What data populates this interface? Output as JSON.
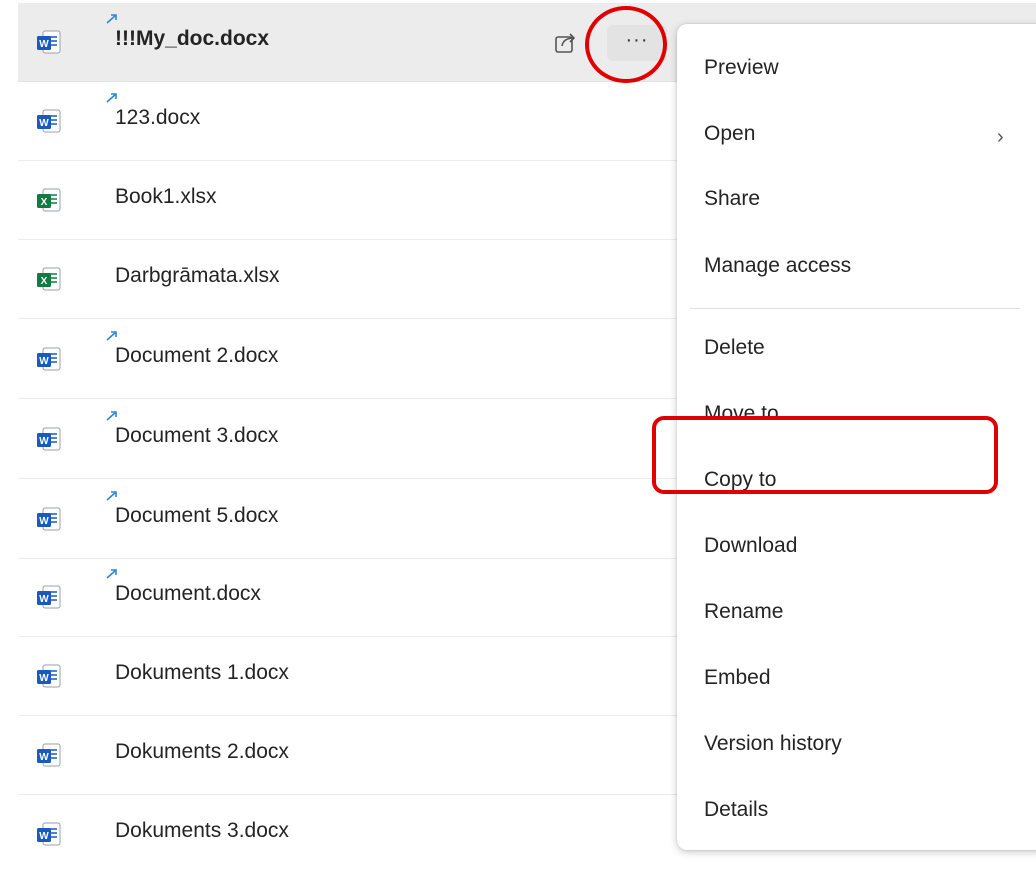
{
  "files": [
    {
      "name": "!!!My_doc.docx",
      "type": "word",
      "synced": true,
      "selected": true
    },
    {
      "name": "123.docx",
      "type": "word",
      "synced": true
    },
    {
      "name": "Book1.xlsx",
      "type": "excel",
      "synced": false
    },
    {
      "name": "Darbgrāmata.xlsx",
      "type": "excel",
      "synced": false
    },
    {
      "name": "Document 2.docx",
      "type": "word",
      "synced": true
    },
    {
      "name": "Document 3.docx",
      "type": "word",
      "synced": true
    },
    {
      "name": "Document 5.docx",
      "type": "word",
      "synced": true
    },
    {
      "name": "Document.docx",
      "type": "word",
      "synced": true
    },
    {
      "name": "Dokuments 1.docx",
      "type": "word",
      "synced": false
    },
    {
      "name": "Dokuments 2.docx",
      "type": "word",
      "synced": false
    },
    {
      "name": "Dokuments 3.docx",
      "type": "word",
      "synced": false
    }
  ],
  "row_actions": {
    "more_label": "···",
    "share_icon": "share-icon"
  },
  "menu": {
    "items": [
      {
        "label": "Preview"
      },
      {
        "label": "Open",
        "submenu": true
      },
      {
        "label": "Share"
      },
      {
        "label": "Manage access"
      },
      {
        "label": "Delete"
      },
      {
        "label": "Move to"
      },
      {
        "label": "Copy to"
      },
      {
        "label": "Download"
      },
      {
        "label": "Rename"
      },
      {
        "label": "Embed"
      },
      {
        "label": "Version history"
      },
      {
        "label": "Details"
      }
    ],
    "chevron": "›"
  },
  "colors": {
    "word": "#185abd",
    "excel": "#107c41",
    "sync": "#2b88d8",
    "highlight": "#e00000",
    "selected_row": "#ececec"
  }
}
